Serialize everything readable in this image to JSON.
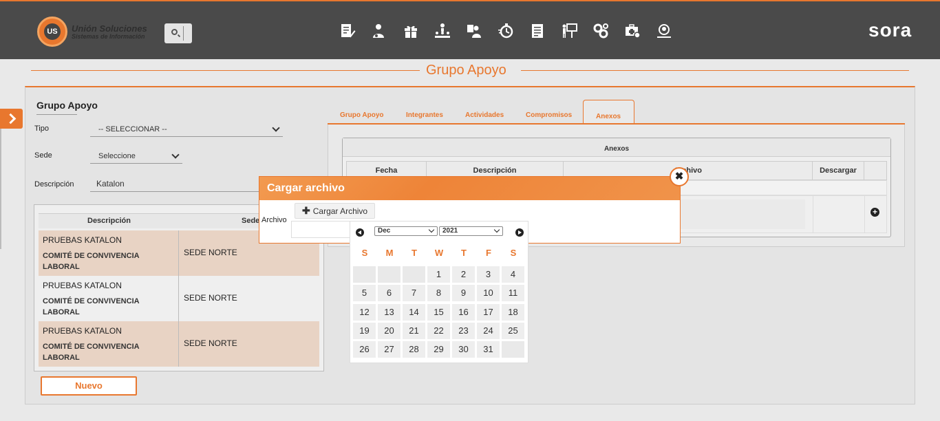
{
  "header": {
    "brand_name": "Unión Soluciones",
    "brand_tagline": "Sistemas de Información",
    "logo_text": "US",
    "product_name": "sora",
    "accent_color": "#e8772e",
    "nav_icons": [
      "document-edit-icon",
      "user-admin-icon",
      "gift-icon",
      "hierarchy-icon",
      "team-icon",
      "stopwatch-icon",
      "report-icon",
      "presentation-icon",
      "gears-icon",
      "medical-case-icon",
      "evaluation-icon"
    ]
  },
  "page": {
    "title": "Grupo Apoyo"
  },
  "form": {
    "section_title": "Grupo Apoyo",
    "tipo_label": "Tipo",
    "tipo_value": "-- SELECCIONAR --",
    "sede_label": "Sede",
    "sede_value": "Seleccione",
    "descripcion_label": "Descripción",
    "descripcion_value": "Katalon"
  },
  "grid": {
    "columns": [
      "Descripción",
      "Sede"
    ],
    "rows": [
      {
        "line1": "PRUEBAS KATALON",
        "line2": "COMITÉ DE CONVIVENCIA LABORAL",
        "sede": "SEDE NORTE"
      },
      {
        "line1": "PRUEBAS KATALON",
        "line2": "COMITÉ DE CONVIVENCIA LABORAL",
        "sede": "SEDE NORTE"
      },
      {
        "line1": "PRUEBAS KATALON",
        "line2": "COMITÉ DE CONVIVENCIA LABORAL",
        "sede": "SEDE NORTE"
      }
    ],
    "new_button": "Nuevo"
  },
  "tabs": [
    "Grupo Apoyo",
    "Integrantes",
    "Actividades",
    "Compromisos",
    "Anexos"
  ],
  "active_tab": "Anexos",
  "anexos": {
    "title": "Anexos",
    "columns": [
      "Fecha",
      "Descripción",
      "Archivo",
      "Descargar"
    ]
  },
  "modal": {
    "title": "Cargar archivo",
    "archivo_label": "Archivo",
    "upload_button": "Cargar Archivo",
    "close_glyph": "✖",
    "upload_glyph": "✚",
    "add_glyph": "+"
  },
  "calendar": {
    "month": "Dec",
    "year": "2021",
    "weekdays": [
      "S",
      "M",
      "T",
      "W",
      "T",
      "F",
      "S"
    ],
    "weeks": [
      [
        "",
        "",
        "",
        "1",
        "2",
        "3",
        "4"
      ],
      [
        "5",
        "6",
        "7",
        "8",
        "9",
        "10",
        "11"
      ],
      [
        "12",
        "13",
        "14",
        "15",
        "16",
        "17",
        "18"
      ],
      [
        "19",
        "20",
        "21",
        "22",
        "23",
        "24",
        "25"
      ],
      [
        "26",
        "27",
        "28",
        "29",
        "30",
        "31",
        ""
      ]
    ]
  }
}
